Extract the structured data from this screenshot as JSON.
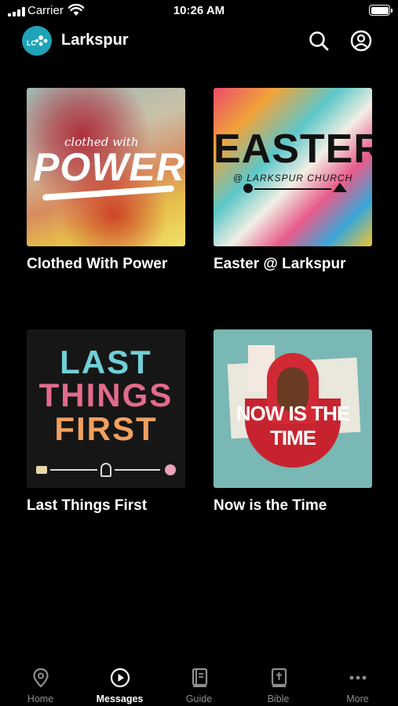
{
  "status_bar": {
    "carrier": "Carrier",
    "time": "10:26 AM"
  },
  "header": {
    "app_title": "Larkspur",
    "logo_text": "LC"
  },
  "messages": [
    {
      "title": "Clothed With Power",
      "art_small": "clothed with",
      "art_big": "POWER"
    },
    {
      "title": "Easter @ Larkspur",
      "art_big": "EASTER",
      "art_sub": "@ LARKSPUR CHURCH"
    },
    {
      "title": "Last Things First",
      "art_line1": "LAST",
      "art_line2": "THINGS",
      "art_line3": "FIRST"
    },
    {
      "title": "Now is the Time",
      "art_big": "NOW IS THE TIME"
    }
  ],
  "tabs": [
    {
      "label": "Home",
      "icon": "location-pin-icon"
    },
    {
      "label": "Messages",
      "icon": "play-circle-icon",
      "active": true
    },
    {
      "label": "Guide",
      "icon": "guide-book-icon"
    },
    {
      "label": "Bible",
      "icon": "bible-icon"
    },
    {
      "label": "More",
      "icon": "more-dots-icon"
    }
  ],
  "colors": {
    "background": "#000000",
    "accent": "#1fa3b8",
    "inactive_tab": "#8e8e93"
  }
}
